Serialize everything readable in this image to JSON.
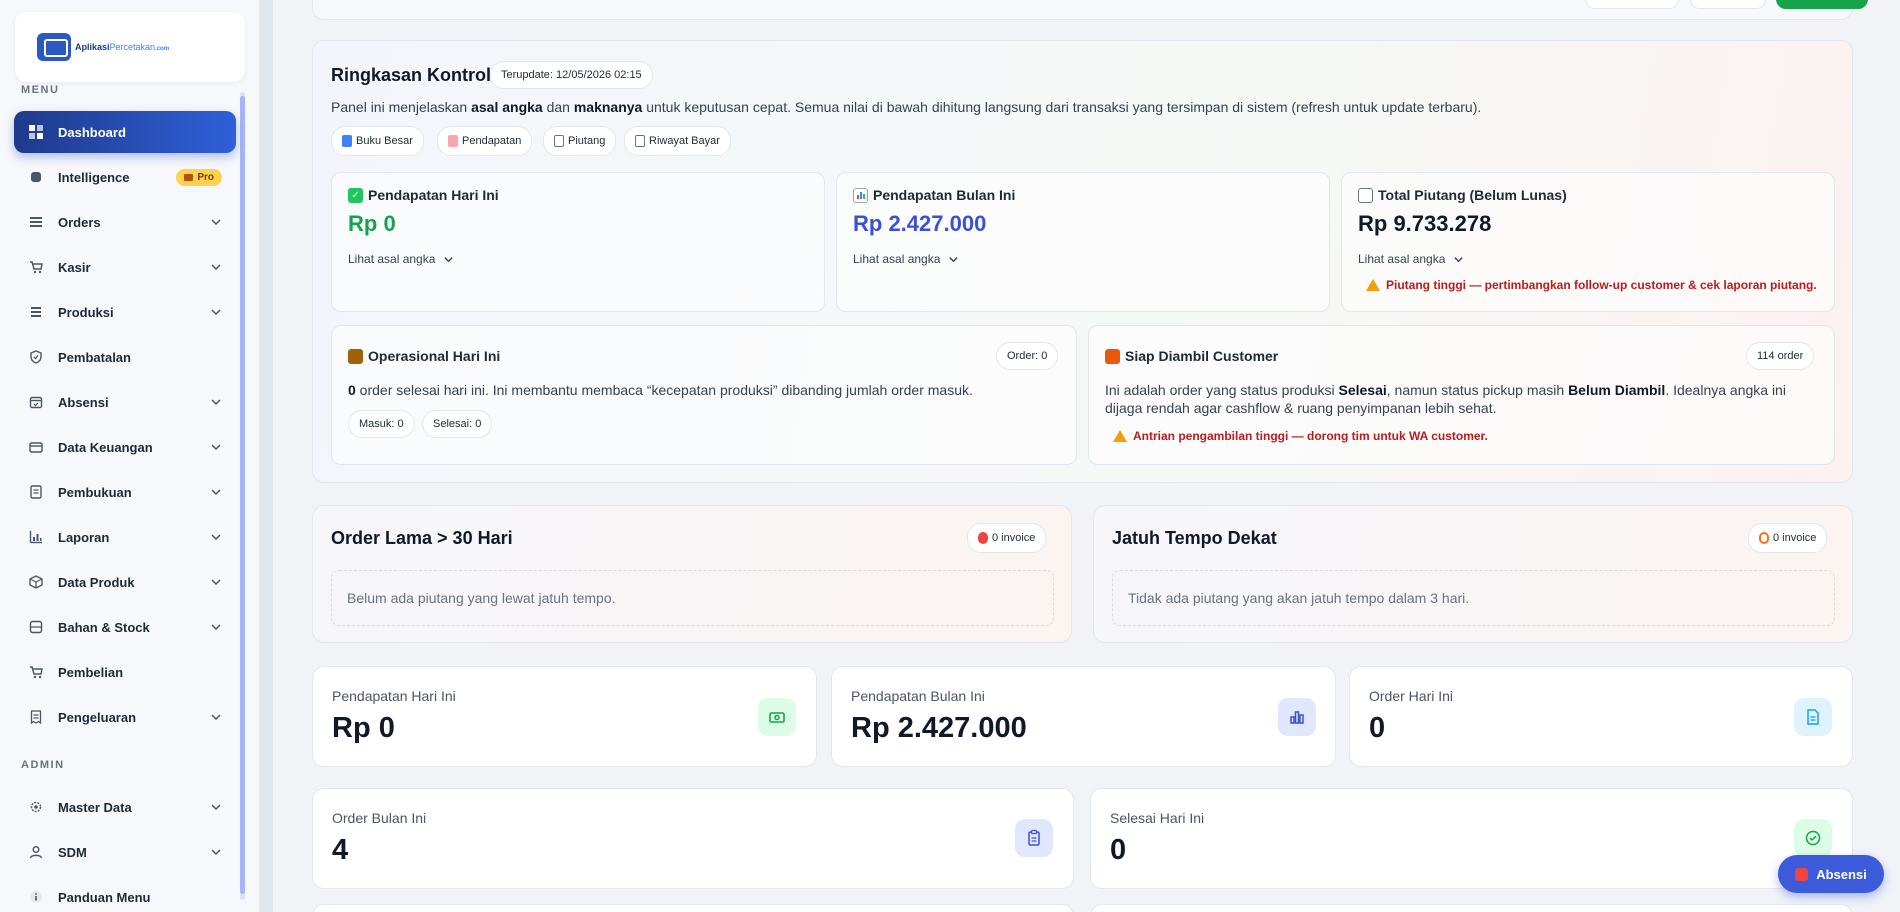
{
  "brand": {
    "logo_main": "Aplikasi",
    "logo_accent": "Percetakan",
    "logo_suffix": ".com"
  },
  "sidebar": {
    "menu_label": "MENU",
    "admin_label": "ADMIN",
    "items": [
      {
        "label": "Dashboard",
        "icon": "dashboard-icon"
      },
      {
        "label": "Intelligence",
        "icon": "chip-icon",
        "badge": "Pro"
      },
      {
        "label": "Orders",
        "icon": "list-icon"
      },
      {
        "label": "Kasir",
        "icon": "cart-icon"
      },
      {
        "label": "Produksi",
        "icon": "list-icon"
      },
      {
        "label": "Pembatalan",
        "icon": "shield-icon"
      },
      {
        "label": "Absensi",
        "icon": "calendar-icon"
      },
      {
        "label": "Data Keuangan",
        "icon": "wallet-icon"
      },
      {
        "label": "Pembukuan",
        "icon": "book-icon"
      },
      {
        "label": "Laporan",
        "icon": "bar-chart-icon"
      },
      {
        "label": "Data Produk",
        "icon": "box-icon"
      },
      {
        "label": "Bahan & Stock",
        "icon": "database-icon"
      },
      {
        "label": "Pembelian",
        "icon": "cart-icon"
      },
      {
        "label": "Pengeluaran",
        "icon": "receipt-icon"
      }
    ],
    "admin_items": [
      {
        "label": "Master Data",
        "icon": "gear-icon"
      },
      {
        "label": "SDM",
        "icon": "user-icon"
      },
      {
        "label": "Panduan Menu",
        "icon": "info-icon"
      }
    ]
  },
  "ringkasan": {
    "title": "Ringkasan Kontrol",
    "updated": "Terupdate: 12/05/2026 02:15",
    "desc_1": "Panel ini menjelaskan ",
    "desc_b1": "asal angka",
    "desc_2": " dan ",
    "desc_b2": "maknanya",
    "desc_3": " untuk keputusan cepat. Semua nilai di bawah dihitung langsung dari transaksi yang tersimpan di sistem (refresh untuk update terbaru).",
    "chips": [
      "Buku Besar",
      "Pendapatan",
      "Piutang",
      "Riwayat Bayar"
    ],
    "link_label": "Lihat asal angka",
    "kpis": [
      {
        "title": "Pendapatan Hari Ini",
        "value": "Rp 0",
        "color": "#16a34a"
      },
      {
        "title": "Pendapatan Bulan Ini",
        "value": "Rp 2.427.000",
        "color": "#3b4fd8"
      },
      {
        "title": "Total Piutang (Belum Lunas)",
        "value": "Rp 9.733.278",
        "color": "#111827"
      }
    ],
    "piutang_warning": "Piutang tinggi — pertimbangkan follow-up customer & cek laporan piutang.",
    "operasional": {
      "title": "Operasional Hari Ini",
      "badge": "Order: 0",
      "count": "0",
      "text": " order selesai hari ini. Ini membantu membaca “kecepatan produksi” dibanding jumlah order masuk.",
      "masuk": "Masuk: 0",
      "selesai": "Selesai: 0"
    },
    "siap_diambil": {
      "title": "Siap Diambil Customer",
      "badge": "114 order",
      "line1_a": "Ini adalah order yang status produksi ",
      "line1_b": "Selesai",
      "line1_c": ", namun status pickup masih ",
      "line1_d": "Belum Diambil",
      "line1_e": ". Idealnya angka ini",
      "line2": "dijaga rendah agar cashflow & ruang penyimpanan lebih sehat.",
      "warning": "Antrian pengambilan tinggi — dorong tim untuk WA customer."
    }
  },
  "order_lama": {
    "title": "Order Lama > 30 Hari",
    "badge": "0 invoice",
    "empty": "Belum ada piutang yang lewat jatuh tempo."
  },
  "jatuh_tempo": {
    "title": "Jatuh Tempo Dekat",
    "badge": "0 invoice",
    "empty": "Tidak ada piutang yang akan jatuh tempo dalam 3 hari."
  },
  "stats": [
    {
      "label": "Pendapatan Hari Ini",
      "value": "Rp 0",
      "icon": "cash-icon"
    },
    {
      "label": "Pendapatan Bulan Ini",
      "value": "Rp 2.427.000",
      "icon": "bar-chart-icon"
    },
    {
      "label": "Order Hari Ini",
      "value": "0",
      "icon": "document-icon"
    },
    {
      "label": "Order Bulan Ini",
      "value": "4",
      "icon": "clipboard-icon"
    },
    {
      "label": "Selesai Hari Ini",
      "value": "0",
      "icon": "check-circle-icon"
    }
  ],
  "floating": {
    "absensi_label": "Absensi"
  },
  "colors": {
    "primary": "#2f5fd8",
    "success": "#16a34a",
    "danger": "#b91c1c",
    "warning": "#f59e0b"
  }
}
